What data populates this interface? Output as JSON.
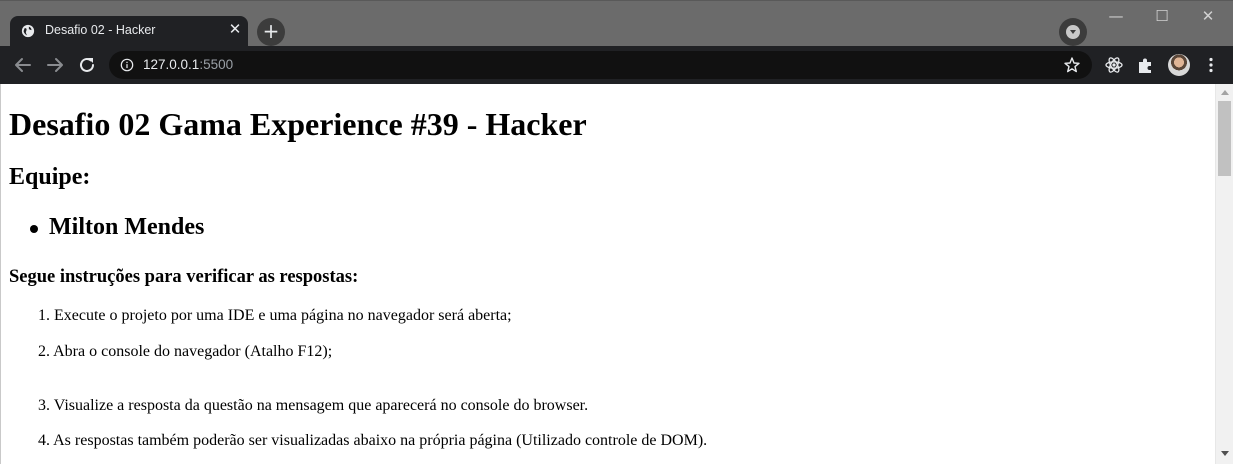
{
  "browser": {
    "tab": {
      "title": "Desafio 02 - Hacker",
      "close_symbol": "✕",
      "favicon": "globe-icon"
    },
    "new_tab_symbol": "+",
    "window_controls": {
      "minimize": "—",
      "maximize": "☐",
      "close": "✕"
    },
    "address_bar": {
      "host": "127.0.0.1",
      "port": ":5500",
      "security_icon": "info-icon"
    },
    "toolbar_icons": [
      "back-arrow-icon",
      "forward-arrow-icon",
      "reload-icon",
      "star-icon",
      "react-devtools-icon",
      "extensions-puzzle-icon",
      "avatar",
      "more-vert-icon"
    ]
  },
  "page": {
    "title": "Desafio 02 Gama Experience #39 - Hacker",
    "team_heading": "Equipe:",
    "team_members": [
      "Milton Mendes"
    ],
    "instructions_heading": "Segue instruções para verificar as respostas:",
    "steps": [
      {
        "num": "1.",
        "text": "Execute o projeto por uma IDE e uma página no navegador será aberta;"
      },
      {
        "num": "2.",
        "text": "Abra o console do navegador (Atalho F12);"
      },
      {
        "num": "3.",
        "text": "Visualize a resposta da questão na mensagem que aparecerá no console do browser."
      },
      {
        "num": "4.",
        "text": "As respostas também poderão ser visualizadas abaixo na própria página (Utilizado controle de DOM)."
      }
    ]
  },
  "colors": {
    "tab_strip": "#6b6b6b",
    "toolbar": "#202124",
    "omnibox": "#111111",
    "page_bg": "#ffffff"
  }
}
